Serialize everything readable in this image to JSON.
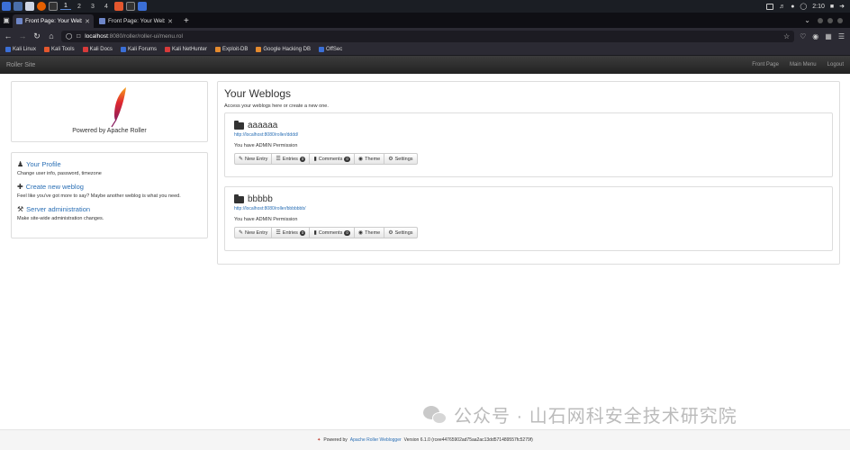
{
  "os_panel": {
    "workspaces": [
      "1",
      "2",
      "3",
      "4"
    ],
    "clock": "2:10"
  },
  "browser": {
    "tabs": [
      {
        "title": "Front Page: Your Weblog",
        "active": true
      },
      {
        "title": "Front Page: Your Weblog",
        "active": false
      }
    ],
    "new_tab": "+",
    "url_host": "localhost",
    "url_path": ":8080/roller/roller-ui/menu.rol",
    "bookmarks": [
      {
        "label": "Kali Linux",
        "color": "#3b6fd6"
      },
      {
        "label": "Kali Tools",
        "color": "#e4572e"
      },
      {
        "label": "Kali Docs",
        "color": "#d83a3a"
      },
      {
        "label": "Kali Forums",
        "color": "#3b6fd6"
      },
      {
        "label": "Kali NetHunter",
        "color": "#d83a3a"
      },
      {
        "label": "Exploit-DB",
        "color": "#e48a2e"
      },
      {
        "label": "Google Hacking DB",
        "color": "#e48a2e"
      },
      {
        "label": "OffSec",
        "color": "#3b6fd6"
      }
    ]
  },
  "roller": {
    "brand": "Roller Site",
    "menu": [
      "Front Page",
      "Main Menu",
      "Logout"
    ]
  },
  "sidebar": {
    "powered_by": "Powered by Apache Roller",
    "links": [
      {
        "title": "Your Profile",
        "desc": "Change user info, password, timezone",
        "icon": "user-icon"
      },
      {
        "title": "Create new weblog",
        "desc": "Feel like you've got more to say? Maybe another weblog is what you need.",
        "icon": "plus-icon"
      },
      {
        "title": "Server administration",
        "desc": "Make site-wide administration changes.",
        "icon": "wrench-icon"
      }
    ]
  },
  "main": {
    "title": "Your Weblogs",
    "subtitle": "Access your weblogs here or create a new one.",
    "weblogs": [
      {
        "name": "aaaaaa",
        "url": "http://localhost:8080/roller/dddd/",
        "permission": "You have ADMIN Permission",
        "entries_count": "0",
        "comments_count": "0"
      },
      {
        "name": "bbbbb",
        "url": "http://localhost:8080/roller/bbbbbbb/",
        "permission": "You have ADMIN Permission",
        "entries_count": "0",
        "comments_count": "0"
      }
    ],
    "buttons": {
      "new_entry": "New Entry",
      "entries": "Entries",
      "comments": "Comments",
      "theme": "Theme",
      "settings": "Settings"
    }
  },
  "footer": {
    "prefix": "Powered by",
    "link": "Apache Roller Weblogger",
    "version": "Version 6.1.0 (rcee44765902ad75aa2ac13dd571489557fc5279f)"
  },
  "watermark": {
    "text": "公众号 · 山石网科安全技术研究院"
  },
  "colors": {
    "link": "#2a6fb5",
    "header_dark": "#222222",
    "panel_border": "#dddddd"
  }
}
